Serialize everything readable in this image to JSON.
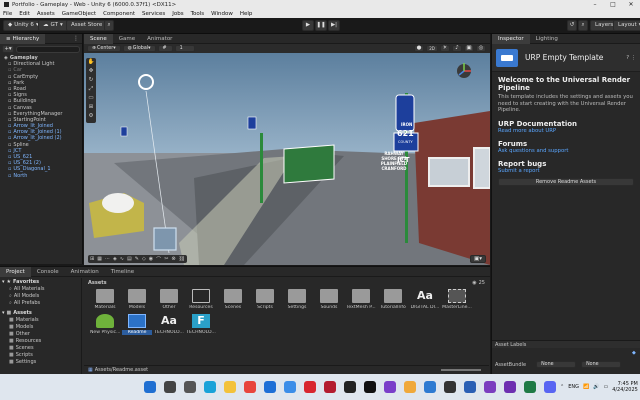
{
  "window": {
    "title": "Portfolio - Gameplay - Web - Unity 6 (6000.0.37f1) <DX11>"
  },
  "menu": [
    "File",
    "Edit",
    "Assets",
    "GameObject",
    "Component",
    "Services",
    "Jobs",
    "Tools",
    "Window",
    "Help"
  ],
  "toolbar": {
    "account": "Unity 6",
    "user": "GT",
    "asset_store": "Asset Store",
    "layers": "Layers",
    "layout": "Layout"
  },
  "hierarchy": {
    "tab": "Hierarchy",
    "items": [
      {
        "label": "Gameplay",
        "style": "bold",
        "indent": 2
      },
      {
        "label": "Directional Light",
        "style": "",
        "indent": 4
      },
      {
        "label": "Car",
        "style": "dim",
        "indent": 4
      },
      {
        "label": "CarEmpty",
        "style": "",
        "indent": 4
      },
      {
        "label": "Park",
        "style": "",
        "indent": 4
      },
      {
        "label": "Road",
        "style": "",
        "indent": 4
      },
      {
        "label": "Signs",
        "style": "",
        "indent": 4
      },
      {
        "label": "Buildings",
        "style": "",
        "indent": 4
      },
      {
        "label": "Canvas",
        "style": "",
        "indent": 4
      },
      {
        "label": "EverythingManager",
        "style": "",
        "indent": 4
      },
      {
        "label": "StartingPoint",
        "style": "",
        "indent": 4
      },
      {
        "label": "Arrow_lit_Joined",
        "style": "blue",
        "indent": 4
      },
      {
        "label": "Arrow_lit_Joined (1)",
        "style": "blue",
        "indent": 4
      },
      {
        "label": "Arrow_lit_Joined (2)",
        "style": "blue",
        "indent": 4
      },
      {
        "label": "Spline",
        "style": "",
        "indent": 4
      },
      {
        "label": "JCT",
        "style": "blue",
        "indent": 4
      },
      {
        "label": "US_621",
        "style": "blue",
        "indent": 4
      },
      {
        "label": "US_621 (2)",
        "style": "blue",
        "indent": 4
      },
      {
        "label": "US_Diagonal_1",
        "style": "blue",
        "indent": 4
      },
      {
        "label": "North",
        "style": "blue",
        "indent": 4
      }
    ]
  },
  "scene": {
    "tabs": [
      "Scene",
      "Game",
      "Animator"
    ],
    "pivot": "Center",
    "space": "Global",
    "snap": "1",
    "persp": "< Persp",
    "signs": {
      "route": "621",
      "route_top": "IRON",
      "route_bottom": "COUNTY",
      "jct": "JCT",
      "green_sign": [
        "RAHWAY",
        "SHORE PTS",
        "PLAINFIELD",
        "CRANFORD"
      ]
    }
  },
  "inspector": {
    "tabs": [
      "Inspector",
      "Lighting"
    ],
    "template_title": "URP Empty Template",
    "welcome_heading": "Welcome to the Universal Render Pipeline",
    "welcome_text": "This template includes the settings and assets you need to start creating with the Universal Render Pipeline.",
    "docs_heading": "URP Documentation",
    "docs_link": "Read more about URP",
    "forums_heading": "Forums",
    "forums_link": "Ask questions and support",
    "bugs_heading": "Report bugs",
    "bugs_link": "Submit a report",
    "remove_button": "Remove Readme Assets",
    "asset_labels": "Asset Labels",
    "asset_bundle_label": "AssetBundle",
    "asset_bundle_value": "None",
    "asset_bundle_variant": "None"
  },
  "project": {
    "tabs": [
      "Project",
      "Console",
      "Animation",
      "Timeline"
    ],
    "favorites": {
      "label": "Favorites",
      "items": [
        "All Materials",
        "All Models",
        "All Prefabs"
      ]
    },
    "tree": {
      "label": "Assets",
      "items": [
        "Materials",
        "Models",
        "Other",
        "Resources",
        "Scenes",
        "Scripts",
        "Settings"
      ]
    },
    "breadcrumb": "Assets",
    "path": "Assets/Readme.asset",
    "count": "25",
    "assets_row1": [
      "Materials",
      "Models",
      "Other",
      "Resources",
      "Scenes",
      "Scripts",
      "Settings",
      "Sounds",
      "TextMesh P...",
      "TutorialInfo",
      "DIGITAL DI...",
      "MasterLine..."
    ],
    "assets_row2": [
      "New Physic...",
      "Readme",
      "TECHNOLO...",
      "TECHNOLO..."
    ],
    "font_glyph": "Aa",
    "f_glyph": "F"
  },
  "taskbar": {
    "lang": "ENG",
    "time": "7:45 PM",
    "date": "4/24/2025"
  },
  "colors": {
    "accent": "#3a79d0",
    "link": "#5aa6ff",
    "sky": "#7fa4c2",
    "sign_blue": "#1d3f9c",
    "sign_green": "#2f7a3d"
  }
}
